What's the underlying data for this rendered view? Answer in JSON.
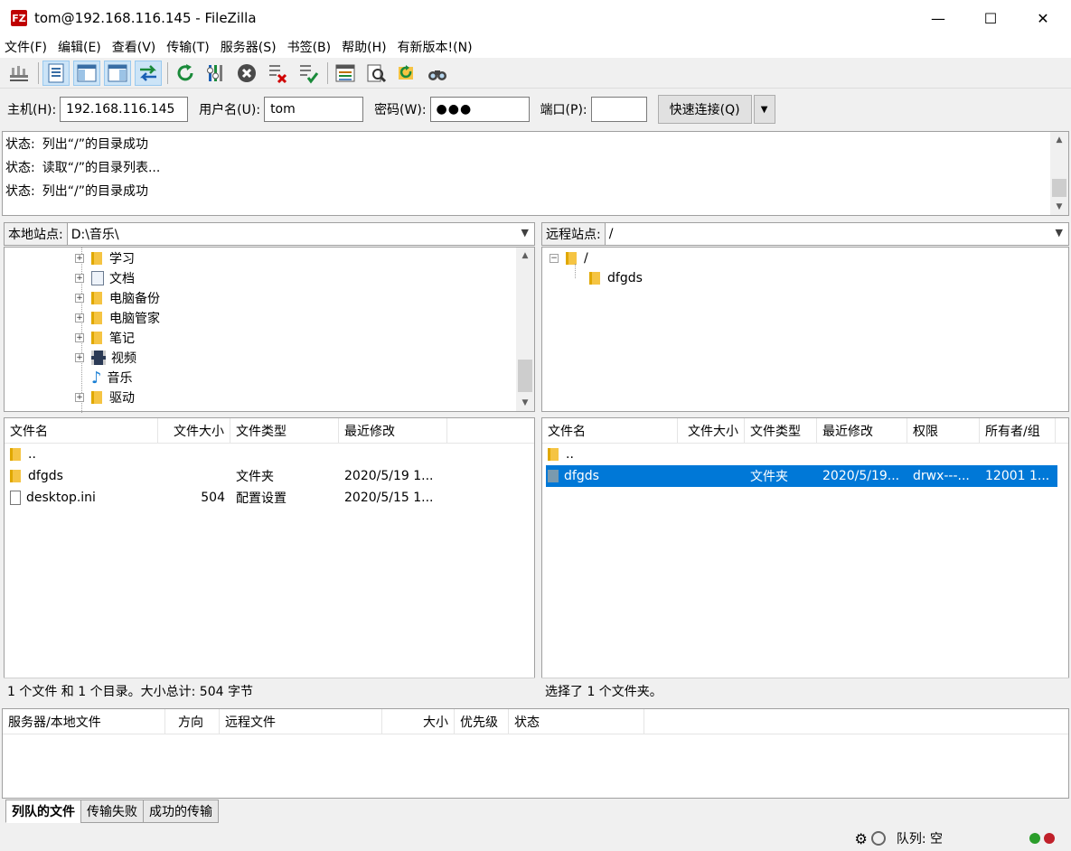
{
  "window": {
    "title": "tom@192.168.116.145 - FileZilla",
    "app_icon_text": "FZ",
    "minimize": "—",
    "maximize": "☐",
    "close": "✕"
  },
  "menu": [
    "文件(F)",
    "编辑(E)",
    "查看(V)",
    "传输(T)",
    "服务器(S)",
    "书签(B)",
    "帮助(H)",
    "有新版本!(N)"
  ],
  "toolbar": {
    "icons": [
      "site-manager-icon",
      "toggle-message-log-icon",
      "toggle-local-tree-icon",
      "toggle-remote-tree-icon",
      "toggle-queue-icon",
      "refresh-icon",
      "process-queue-icon",
      "cancel-icon",
      "disconnect-icon",
      "reconnect-icon",
      "filter-icon",
      "compare-icon",
      "sync-browse-icon",
      "search-icon"
    ]
  },
  "quickconnect": {
    "host_label": "主机(H):",
    "host_value": "192.168.116.145",
    "user_label": "用户名(U):",
    "user_value": "tom",
    "pass_label": "密码(W):",
    "pass_value": "●●●",
    "port_label": "端口(P):",
    "port_value": "",
    "connect_button": "快速连接(Q)"
  },
  "log": [
    {
      "status": "状态:",
      "message": "列出“/”的目录成功"
    },
    {
      "status": "状态:",
      "message": "读取“/”的目录列表..."
    },
    {
      "status": "状态:",
      "message": "列出“/”的目录成功"
    }
  ],
  "local": {
    "site_label": "本地站点:",
    "path": "D:\\音乐\\",
    "tree": [
      {
        "name": "学习",
        "icon": "folder-icon"
      },
      {
        "name": "文档",
        "icon": "documents-icon"
      },
      {
        "name": "电脑备份",
        "icon": "folder-icon"
      },
      {
        "name": "电脑管家",
        "icon": "folder-icon"
      },
      {
        "name": "笔记",
        "icon": "folder-icon"
      },
      {
        "name": "视频",
        "icon": "video-icon"
      },
      {
        "name": "音乐",
        "icon": "music-icon"
      },
      {
        "name": "驱动",
        "icon": "folder-icon"
      }
    ],
    "columns": [
      "文件名",
      "文件大小",
      "文件类型",
      "最近修改"
    ],
    "files": [
      {
        "name": "..",
        "size": "",
        "type": "",
        "modified": ""
      },
      {
        "name": "dfgds",
        "size": "",
        "type": "文件夹",
        "modified": "2020/5/19 1..."
      },
      {
        "name": "desktop.ini",
        "size": "504",
        "type": "配置设置",
        "modified": "2020/5/15 1..."
      }
    ],
    "status": "1 个文件 和 1 个目录。大小总计: 504 字节"
  },
  "remote": {
    "site_label": "远程站点:",
    "path": "/",
    "tree": [
      {
        "name": "/",
        "level": 0
      },
      {
        "name": "dfgds",
        "level": 1
      }
    ],
    "columns": [
      "文件名",
      "文件大小",
      "文件类型",
      "最近修改",
      "权限",
      "所有者/组"
    ],
    "files": [
      {
        "name": "..",
        "size": "",
        "type": "",
        "modified": "",
        "perms": "",
        "owner": ""
      },
      {
        "name": "dfgds",
        "size": "",
        "type": "文件夹",
        "modified": "2020/5/19...",
        "perms": "drwx---...",
        "owner": "12001 1..."
      }
    ],
    "status": "选择了 1 个文件夹。"
  },
  "queue": {
    "columns": [
      "服务器/本地文件",
      "方向",
      "远程文件",
      "大小",
      "优先级",
      "状态"
    ],
    "tabs": [
      "列队的文件",
      "传输失败",
      "成功的传输"
    ]
  },
  "statusbar": {
    "queue_label": "队列: 空"
  },
  "colors": {
    "selection": "#0078d7",
    "folder": "#f5c443",
    "app_icon": "#bf0000"
  }
}
